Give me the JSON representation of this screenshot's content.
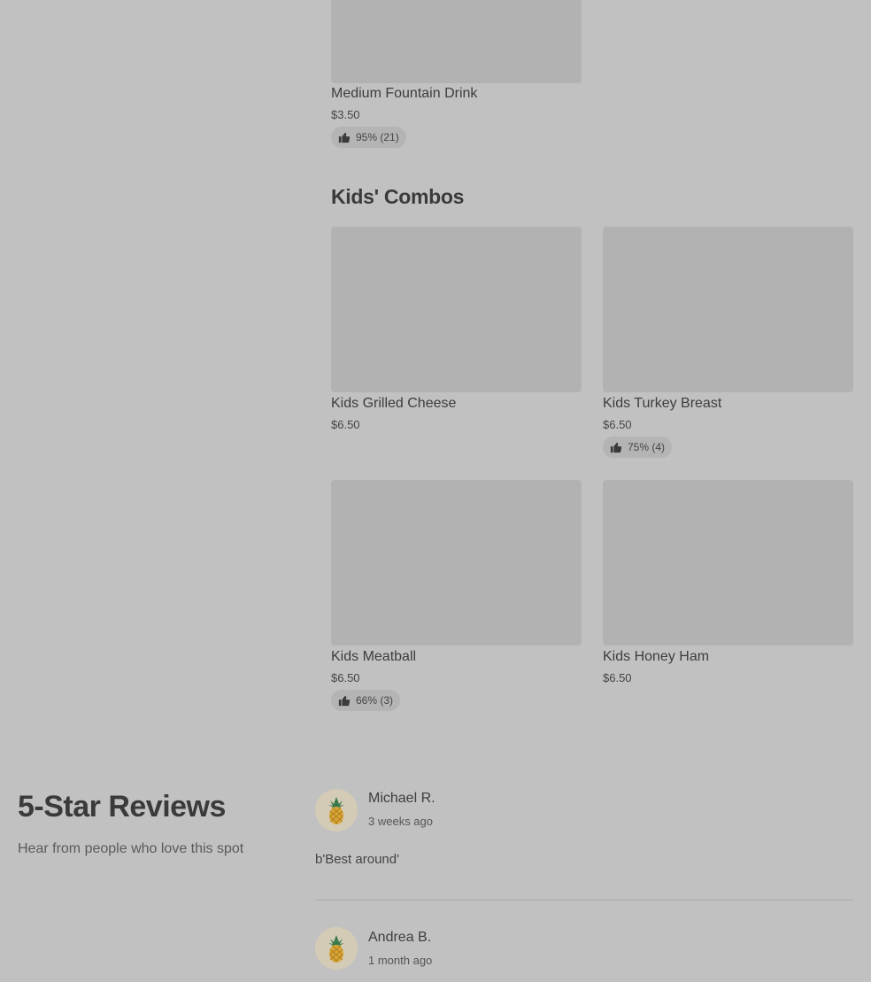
{
  "items_top": [
    {
      "name": "Medium Fountain Drink",
      "price": "$3.50",
      "rating": "95% (21)"
    }
  ],
  "kids_combos": {
    "title": "Kids' Combos",
    "items": [
      {
        "name": "Kids Grilled Cheese",
        "price": "$6.50",
        "rating": null
      },
      {
        "name": "Kids Turkey Breast",
        "price": "$6.50",
        "rating": "75% (4)"
      },
      {
        "name": "Kids Meatball",
        "price": "$6.50",
        "rating": "66% (3)"
      },
      {
        "name": "Kids Honey Ham",
        "price": "$6.50",
        "rating": null
      }
    ]
  },
  "reviews": {
    "title": "5-Star Reviews",
    "subtitle": "Hear from people who love this spot",
    "entries": [
      {
        "name": "Michael R.",
        "when": "3 weeks ago",
        "text": "b'Best around'",
        "avatar_icon": "pineapple-icon"
      },
      {
        "name": "Andrea B.",
        "when": "1 month ago",
        "text": "",
        "avatar_icon": "pineapple-icon"
      }
    ]
  },
  "colors": {
    "background": "#c1c1c1",
    "image_placeholder": "#b2b2b2",
    "badge": "#b4b4b4"
  }
}
